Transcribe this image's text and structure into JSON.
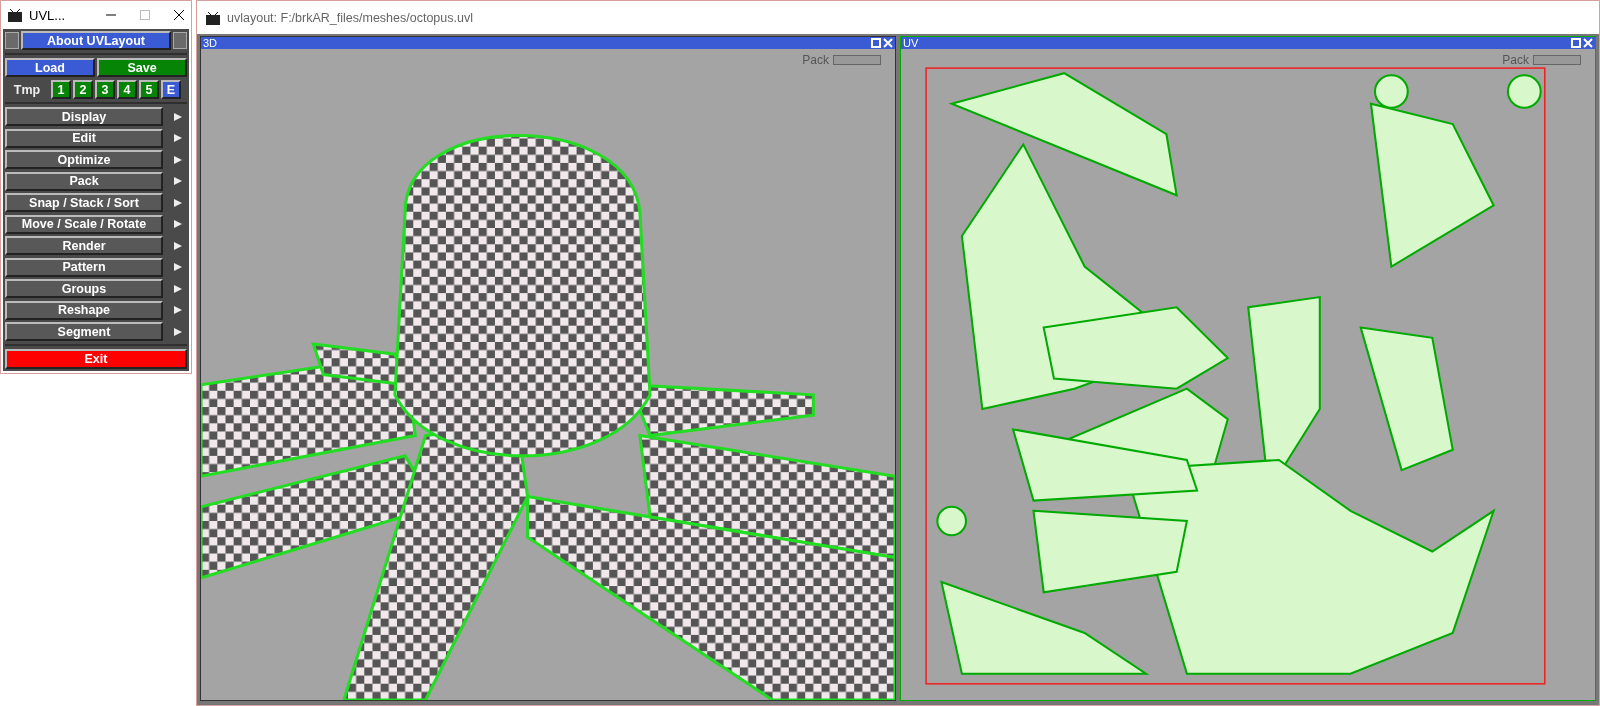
{
  "toolbox": {
    "title": "UVL...",
    "about": "About UVLayout",
    "load": "Load",
    "save": "Save",
    "tmp_label": "Tmp",
    "slots": [
      {
        "label": "1",
        "kind": "slot"
      },
      {
        "label": "2",
        "kind": "slot"
      },
      {
        "label": "3",
        "kind": "slot"
      },
      {
        "label": "4",
        "kind": "slot"
      },
      {
        "label": "5",
        "kind": "slot"
      },
      {
        "label": "E",
        "kind": "edit"
      }
    ],
    "menu": [
      "Display",
      "Edit",
      "Optimize",
      "Pack",
      "Snap / Stack / Sort",
      "Move / Scale / Rotate",
      "Render",
      "Pattern",
      "Groups",
      "Reshape",
      "Segment"
    ],
    "exit": "Exit"
  },
  "main_window": {
    "title": "uvlayout: F:/brkAR_files/meshes/octopus.uvl"
  },
  "viewports": [
    {
      "title": "3D",
      "kind": "model",
      "pack_label": "Pack",
      "level": 0
    },
    {
      "title": "UV",
      "kind": "uv",
      "pack_label": "Pack",
      "level": 0
    }
  ]
}
